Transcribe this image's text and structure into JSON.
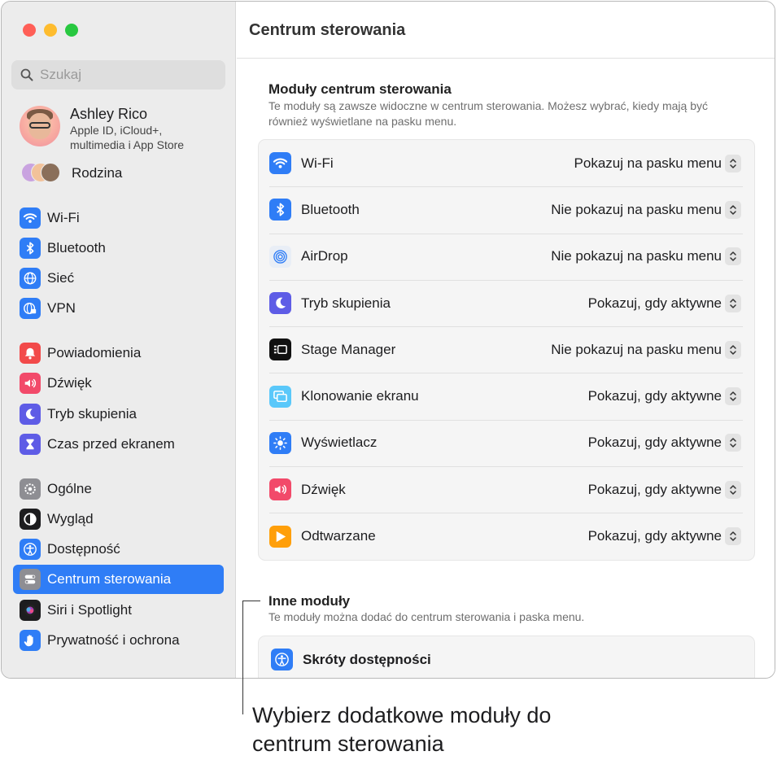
{
  "window": {
    "title": "Centrum sterowania"
  },
  "search": {
    "placeholder": "Szukaj"
  },
  "profile": {
    "name": "Ashley Rico",
    "subtitle": "Apple ID, iCloud+, multimedia i App Store"
  },
  "family": {
    "label": "Rodzina"
  },
  "sidebar": {
    "items": [
      {
        "label": "Wi-Fi",
        "icon": "wifi-icon",
        "color": "#2f7df6"
      },
      {
        "label": "Bluetooth",
        "icon": "bluetooth-icon",
        "color": "#2f7df6"
      },
      {
        "label": "Sieć",
        "icon": "globe-icon",
        "color": "#2f7df6"
      },
      {
        "label": "VPN",
        "icon": "vpn-globe-icon",
        "color": "#2f7df6"
      },
      {
        "label": "Powiadomienia",
        "icon": "bell-icon",
        "color": "#f24a4a"
      },
      {
        "label": "Dźwięk",
        "icon": "speaker-icon",
        "color": "#f24a6a"
      },
      {
        "label": "Tryb skupienia",
        "icon": "moon-icon",
        "color": "#5e5ce6"
      },
      {
        "label": "Czas przed ekranem",
        "icon": "hourglass-icon",
        "color": "#5e5ce6"
      },
      {
        "label": "Ogólne",
        "icon": "gear-icon",
        "color": "#8e8e93"
      },
      {
        "label": "Wygląd",
        "icon": "appearance-icon",
        "color": "#1d1d1f"
      },
      {
        "label": "Dostępność",
        "icon": "accessibility-icon",
        "color": "#2f7df6"
      },
      {
        "label": "Centrum sterowania",
        "icon": "control-center-icon",
        "color": "#8e8e93",
        "active": true
      },
      {
        "label": "Siri i Spotlight",
        "icon": "siri-icon",
        "color": "#1d1d1f"
      },
      {
        "label": "Prywatność i ochrona",
        "icon": "hand-icon",
        "color": "#2f7df6"
      }
    ]
  },
  "modules_section": {
    "title": "Moduły centrum sterowania",
    "description": "Te moduły są zawsze widoczne w centrum sterowania. Możesz wybrać, kiedy mają być również wyświetlane na pasku menu.",
    "rows": [
      {
        "label": "Wi-Fi",
        "icon": "wifi-icon",
        "color": "#2f7df6",
        "value": "Pokazuj na pasku menu"
      },
      {
        "label": "Bluetooth",
        "icon": "bluetooth-icon",
        "color": "#2f7df6",
        "value": "Nie pokazuj na pasku menu"
      },
      {
        "label": "AirDrop",
        "icon": "airdrop-icon",
        "color": "#e9eef6",
        "value": "Nie pokazuj na pasku menu"
      },
      {
        "label": "Tryb skupienia",
        "icon": "moon-icon",
        "color": "#5e5ce6",
        "value": "Pokazuj, gdy aktywne"
      },
      {
        "label": "Stage Manager",
        "icon": "stage-manager-icon",
        "color": "#111111",
        "value": "Nie pokazuj na pasku menu"
      },
      {
        "label": "Klonowanie ekranu",
        "icon": "screen-mirroring-icon",
        "color": "#5ac8fa",
        "value": "Pokazuj, gdy aktywne"
      },
      {
        "label": "Wyświetlacz",
        "icon": "brightness-icon",
        "color": "#2f7df6",
        "value": "Pokazuj, gdy aktywne"
      },
      {
        "label": "Dźwięk",
        "icon": "speaker-icon",
        "color": "#f24a6a",
        "value": "Pokazuj, gdy aktywne"
      },
      {
        "label": "Odtwarzane",
        "icon": "play-icon",
        "color": "#ff9f0a",
        "value": "Pokazuj, gdy aktywne"
      }
    ]
  },
  "other_section": {
    "title": "Inne moduły",
    "description": "Te moduły można dodać do centrum sterowania i paska menu.",
    "rows": [
      {
        "label": "Skróty dostępności",
        "icon": "accessibility-icon",
        "color": "#2f7df6"
      }
    ]
  },
  "callout": {
    "text": "Wybierz dodatkowe moduły do centrum sterowania"
  }
}
